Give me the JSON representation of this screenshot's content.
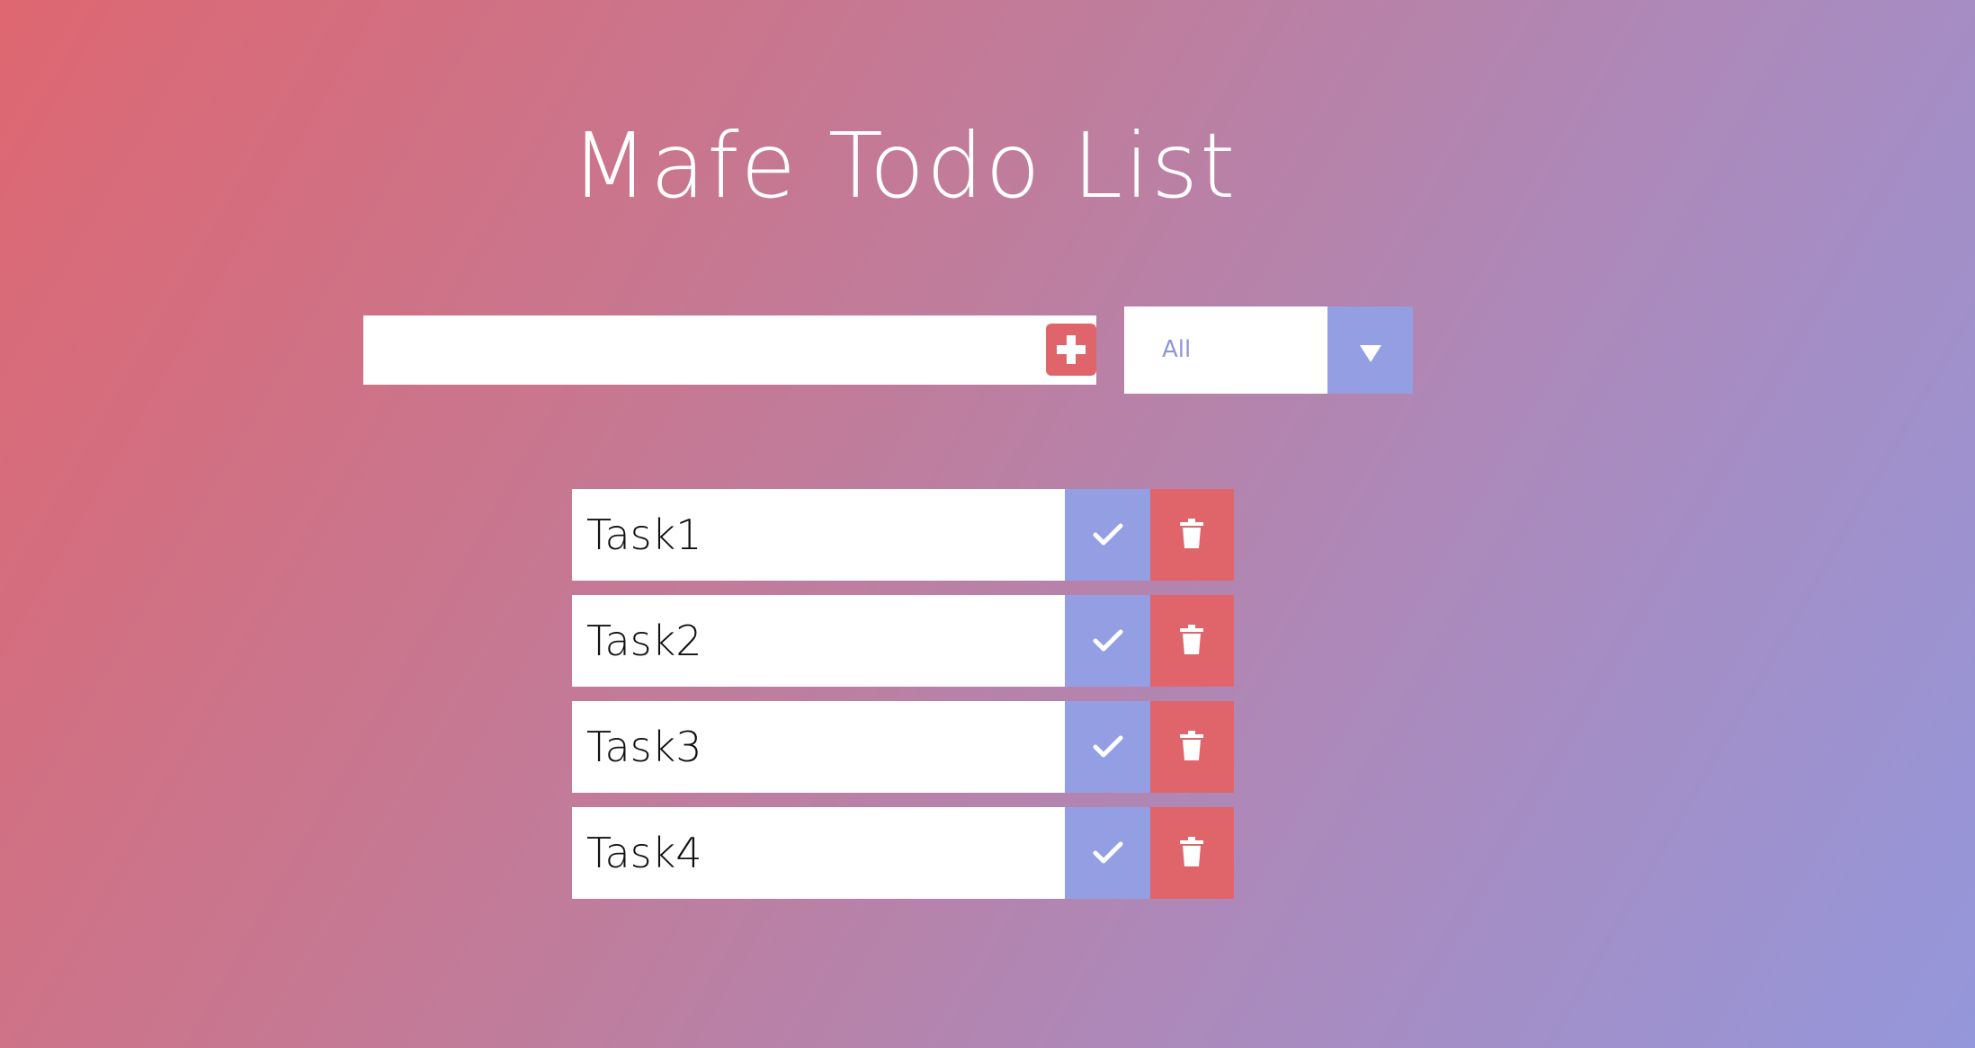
{
  "header": {
    "title": "Mafe Todo List"
  },
  "form": {
    "input_value": "",
    "input_placeholder": "",
    "add_icon": "plus-square-icon",
    "filter": {
      "selected": "All",
      "arrow_icon": "triangle-down-icon"
    }
  },
  "todos": [
    {
      "text": "Task1",
      "complete_icon": "check-icon",
      "delete_icon": "trash-icon"
    },
    {
      "text": "Task2",
      "complete_icon": "check-icon",
      "delete_icon": "trash-icon"
    },
    {
      "text": "Task3",
      "complete_icon": "check-icon",
      "delete_icon": "trash-icon"
    },
    {
      "text": "Task4",
      "complete_icon": "check-icon",
      "delete_icon": "trash-icon"
    }
  ],
  "colors": {
    "background_start": "#de6771",
    "background_end": "#9497db",
    "accent_blue": "#949fe3",
    "accent_red": "#e0656a",
    "surface": "#ffffff"
  }
}
